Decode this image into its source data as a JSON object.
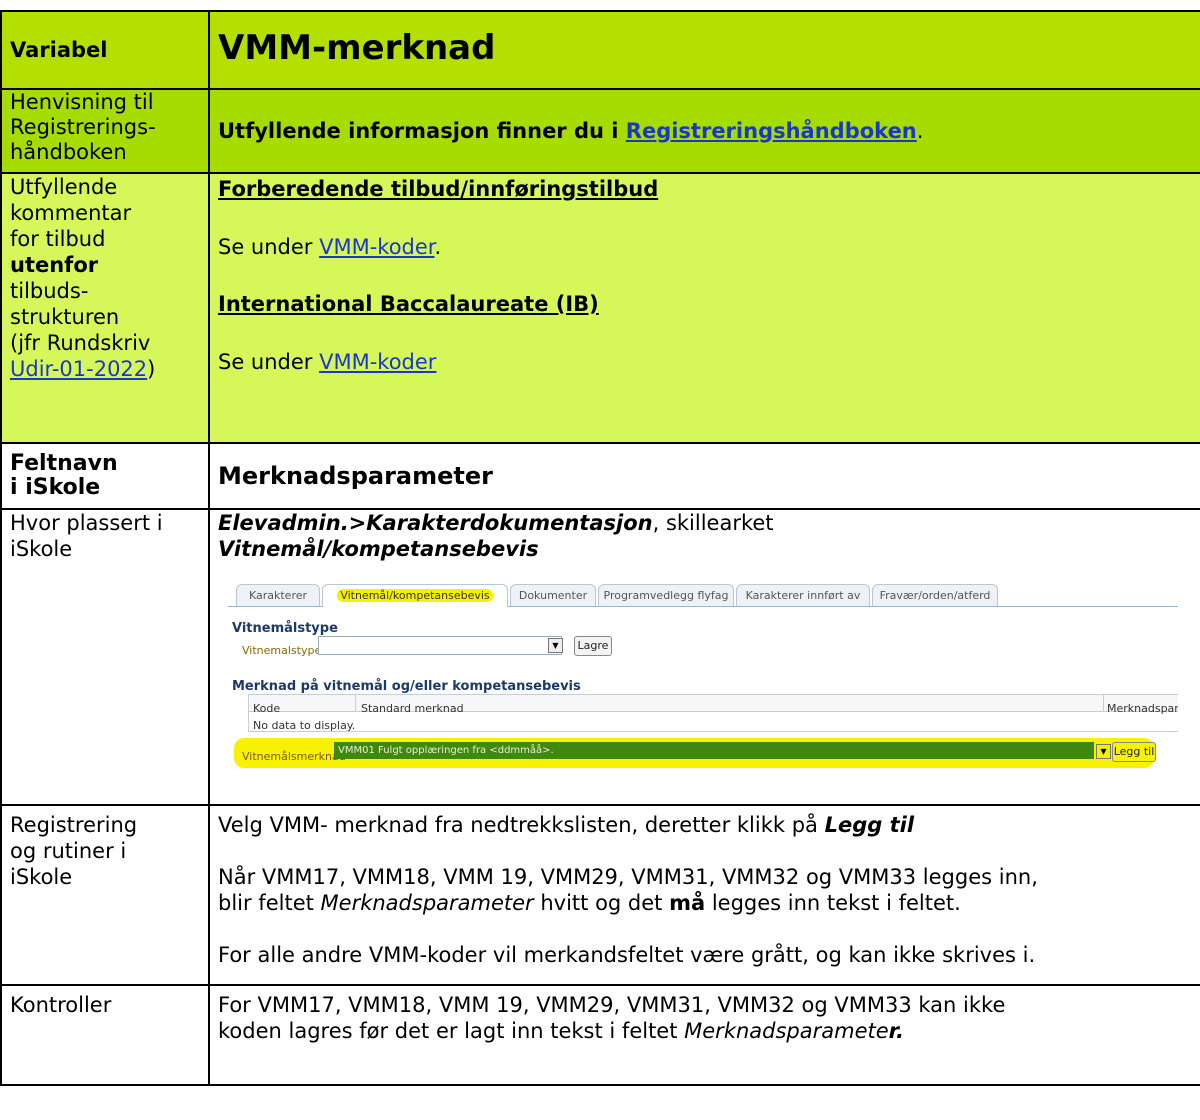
{
  "row1": {
    "label": "Variabel",
    "title": "VMM-merknad"
  },
  "row2": {
    "label_lines": [
      "Henvisning til",
      "Registrerings-",
      "håndboken"
    ],
    "text_before": "Utfyllende informasjon finner du i ",
    "link": "Registreringshåndboken",
    "text_after": "."
  },
  "row3": {
    "label": {
      "l1": "Utfyllende",
      "l2": "kommentar",
      "l3": "for tilbud",
      "l4": "utenfor",
      "l5": "tilbuds-",
      "l6": "strukturen",
      "l7": "(jfr Rundskriv",
      "l8_link": "Udir-01-2022",
      "l8_after": ")"
    },
    "heading1": "Forberedende tilbud/innføringstilbud",
    "se_under_1": "Se under ",
    "link1": "VMM-koder",
    "link1_after": ".",
    "heading2": "International Baccalaureate (IB)",
    "se_under_2": "Se under ",
    "link2": "VMM-koder"
  },
  "row4": {
    "label_lines": [
      "Feltnavn",
      "i iSkole"
    ],
    "title": "Merknadsparameter"
  },
  "row5": {
    "label_lines": [
      "Hvor plassert i",
      "iSkole"
    ],
    "path_bold": "Elevadmin.>Karakterdokumentasjon",
    "path_rest": ", skillearket",
    "tab_bold": "Vitnemål/kompetansebevis",
    "screenshot": {
      "tabs": [
        "Karakterer",
        "Vitnemål/kompetansebevis",
        "Dokumenter",
        "Programvedlegg flyfag",
        "Karakterer innført av",
        "Fravær/orden/atferd"
      ],
      "section1": "Vitnemålstype",
      "field1_label": "Vitnemalstype",
      "save_button": "Lagre",
      "section2": "Merknad på vitnemål og/eller kompetansebevis",
      "col_kode": "Kode",
      "col_standard": "Standard merknad",
      "col_param": "Merknadsparam",
      "no_data": "No data to display.",
      "field2_label": "Vitnemålsmerknad",
      "field2_value": "VMM01 Fulgt opplæringen fra <ddmmåå>.",
      "add_button": "Legg til"
    }
  },
  "row6": {
    "label_lines": [
      "Registrering",
      "og rutiner i",
      "iSkole"
    ],
    "p1_text": "Velg VMM- merknad fra nedtrekkslisten, deretter klikk på ",
    "p1_bold": "Legg til",
    "p2_line1": "Når VMM17, VMM18, VMM 19, VMM29, VMM31, VMM32 og VMM33 legges inn,",
    "p2_a": "blir feltet ",
    "p2_italic": "Merknadsparameter",
    "p2_b": " hvitt og det ",
    "p2_bold": "må",
    "p2_c": " legges inn tekst i feltet.",
    "p3": "For alle andre VMM-koder vil merkandsfeltet være grått, og kan ikke skrives i."
  },
  "row7": {
    "label": "Kontroller",
    "line1": "For VMM17, VMM18, VMM 19, VMM29, VMM31, VMM32 og VMM33 kan ikke",
    "line2_a": "koden lagres før det er lagt inn tekst i feltet ",
    "line2_italic": "Merknadsparamete",
    "line2_bold": "r."
  }
}
